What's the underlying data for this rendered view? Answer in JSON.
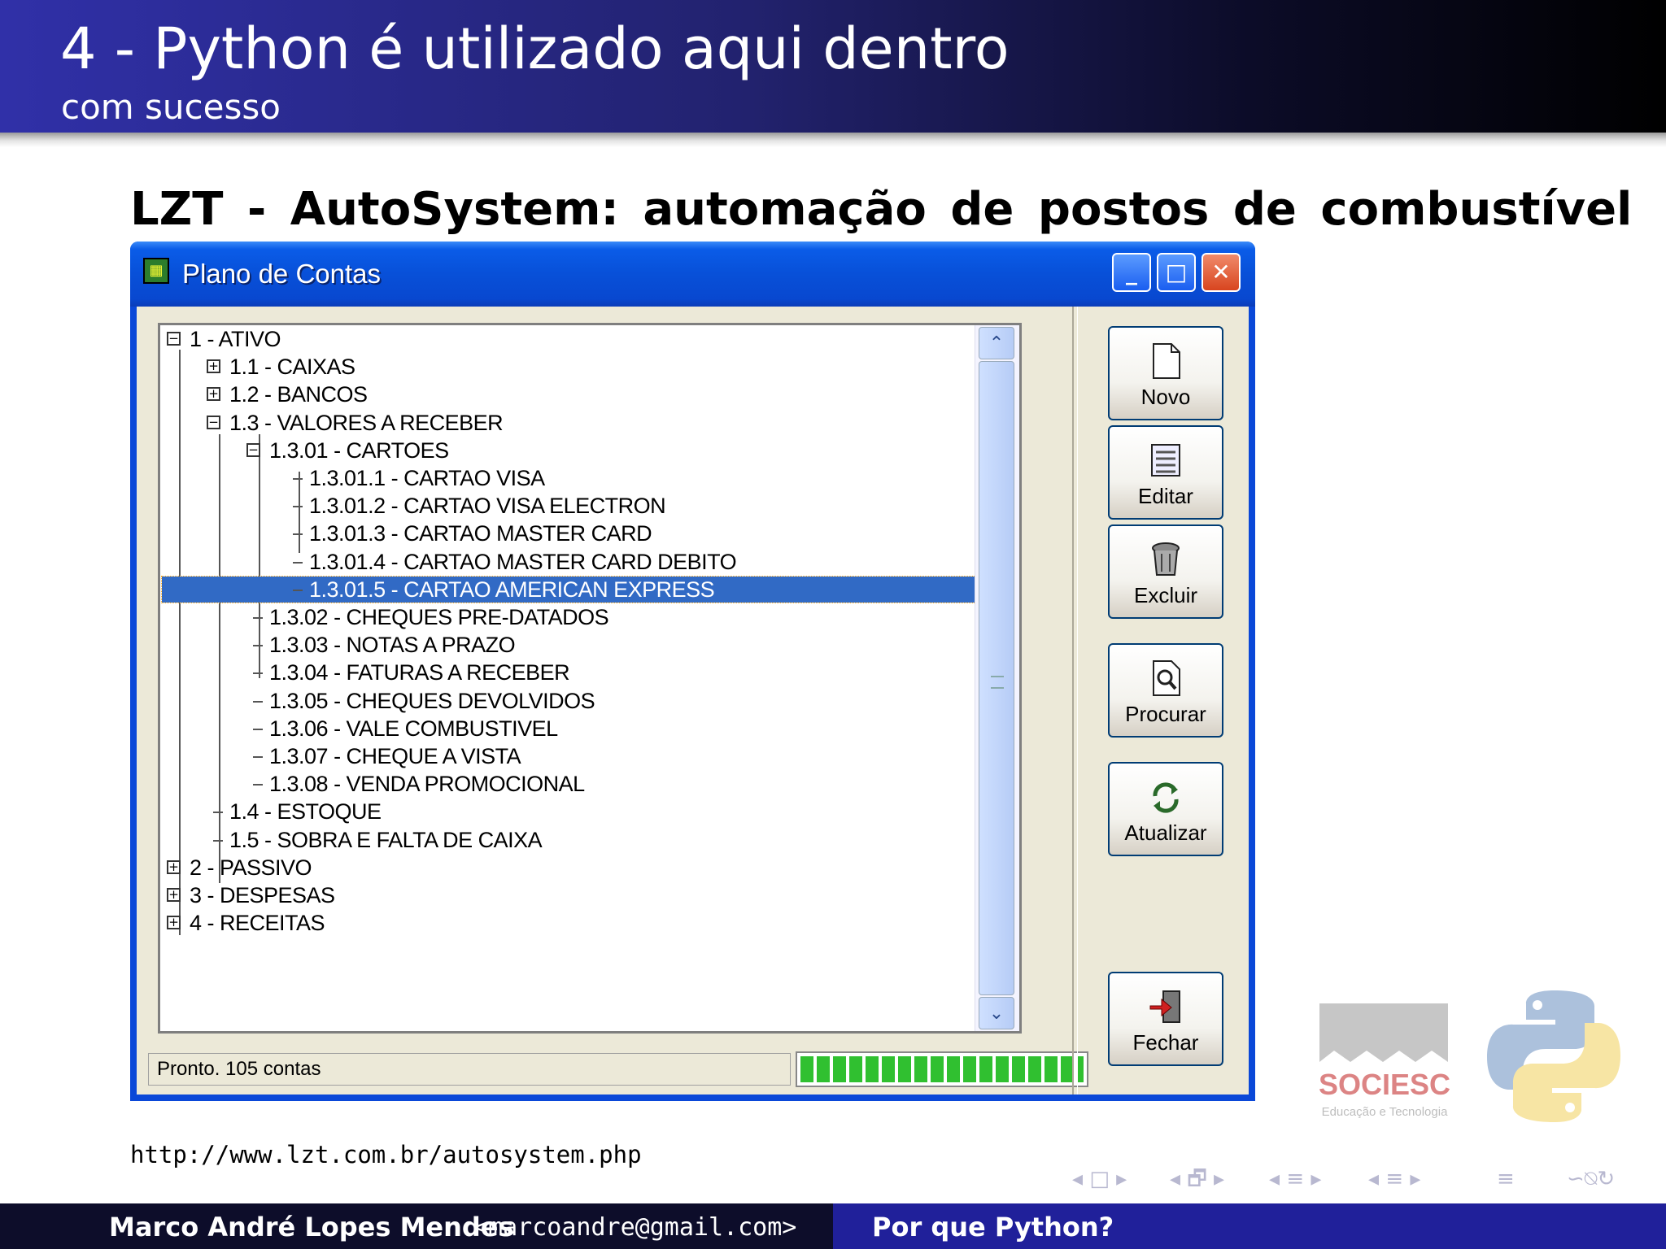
{
  "slide": {
    "title": "4 - Python é utilizado aqui dentro",
    "subtitle": "com sucesso",
    "frame_title": "LZT - AutoSystem: automação de postos de combustível",
    "url": "http://www.lzt.com.br/autosystem.php"
  },
  "window": {
    "title": "Plano de Contas",
    "controls": {
      "minimize": "_",
      "maximize": "□",
      "close": "✕"
    },
    "tree": [
      {
        "label": "1 - ATIVO",
        "depth": 0,
        "box": "−"
      },
      {
        "label": "1.1 - CAIXAS",
        "depth": 1,
        "box": "+"
      },
      {
        "label": "1.2 - BANCOS",
        "depth": 1,
        "box": "+"
      },
      {
        "label": "1.3 - VALORES A RECEBER",
        "depth": 1,
        "box": "−"
      },
      {
        "label": "1.3.01 - CARTOES",
        "depth": 2,
        "box": "−"
      },
      {
        "label": "1.3.01.1 - CARTAO VISA",
        "depth": 3,
        "box": ""
      },
      {
        "label": "1.3.01.2 - CARTAO VISA ELECTRON",
        "depth": 3,
        "box": ""
      },
      {
        "label": "1.3.01.3 - CARTAO MASTER CARD",
        "depth": 3,
        "box": ""
      },
      {
        "label": "1.3.01.4 - CARTAO MASTER CARD DEBITO",
        "depth": 3,
        "box": ""
      },
      {
        "label": "1.3.01.5 - CARTAO AMERICAN EXPRESS",
        "depth": 3,
        "box": "",
        "selected": true
      },
      {
        "label": "1.3.02 - CHEQUES PRE-DATADOS",
        "depth": 2,
        "box": ""
      },
      {
        "label": "1.3.03 - NOTAS A PRAZO",
        "depth": 2,
        "box": ""
      },
      {
        "label": "1.3.04 - FATURAS A RECEBER",
        "depth": 2,
        "box": ""
      },
      {
        "label": "1.3.05 - CHEQUES DEVOLVIDOS",
        "depth": 2,
        "box": ""
      },
      {
        "label": "1.3.06 - VALE COMBUSTIVEL",
        "depth": 2,
        "box": ""
      },
      {
        "label": "1.3.07 - CHEQUE A VISTA",
        "depth": 2,
        "box": ""
      },
      {
        "label": "1.3.08 - VENDA PROMOCIONAL",
        "depth": 2,
        "box": ""
      },
      {
        "label": "1.4 - ESTOQUE",
        "depth": 1,
        "box": ""
      },
      {
        "label": "1.5 - SOBRA  E FALTA DE CAIXA",
        "depth": 1,
        "box": ""
      },
      {
        "label": "2 - PASSIVO",
        "depth": 0,
        "box": "+"
      },
      {
        "label": "3 - DESPESAS",
        "depth": 0,
        "box": "+"
      },
      {
        "label": "4 - RECEITAS",
        "depth": 0,
        "box": "+"
      }
    ],
    "status_text": "Pronto.  105 contas",
    "progress": 1.0,
    "buttons": [
      {
        "label": "Novo",
        "icon": "new-document-icon"
      },
      {
        "label": "Editar",
        "icon": "edit-list-icon"
      },
      {
        "label": "Excluir",
        "icon": "trash-bin-icon"
      },
      {
        "label": "Procurar",
        "icon": "search-document-icon"
      },
      {
        "label": "Atualizar",
        "icon": "refresh-icon"
      },
      {
        "label": "Fechar",
        "icon": "exit-door-icon"
      }
    ]
  },
  "logos": {
    "sociesc_name": "SOCIESC",
    "sociesc_tagline": "Educação e Tecnologia"
  },
  "nav": {
    "frame_nav": "◂ □ ▸",
    "subsection_nav": "◂ 🗗 ▸",
    "section_nav": "◂ ≡ ▸",
    "section_nav2": "◂ ≡ ▸",
    "toc": "≡",
    "search": "∽⍉↻"
  },
  "footer": {
    "author": "Marco André Lopes Mendes",
    "email": "<marcoandre@gmail.com>",
    "talk_title": "Por que Python?"
  }
}
